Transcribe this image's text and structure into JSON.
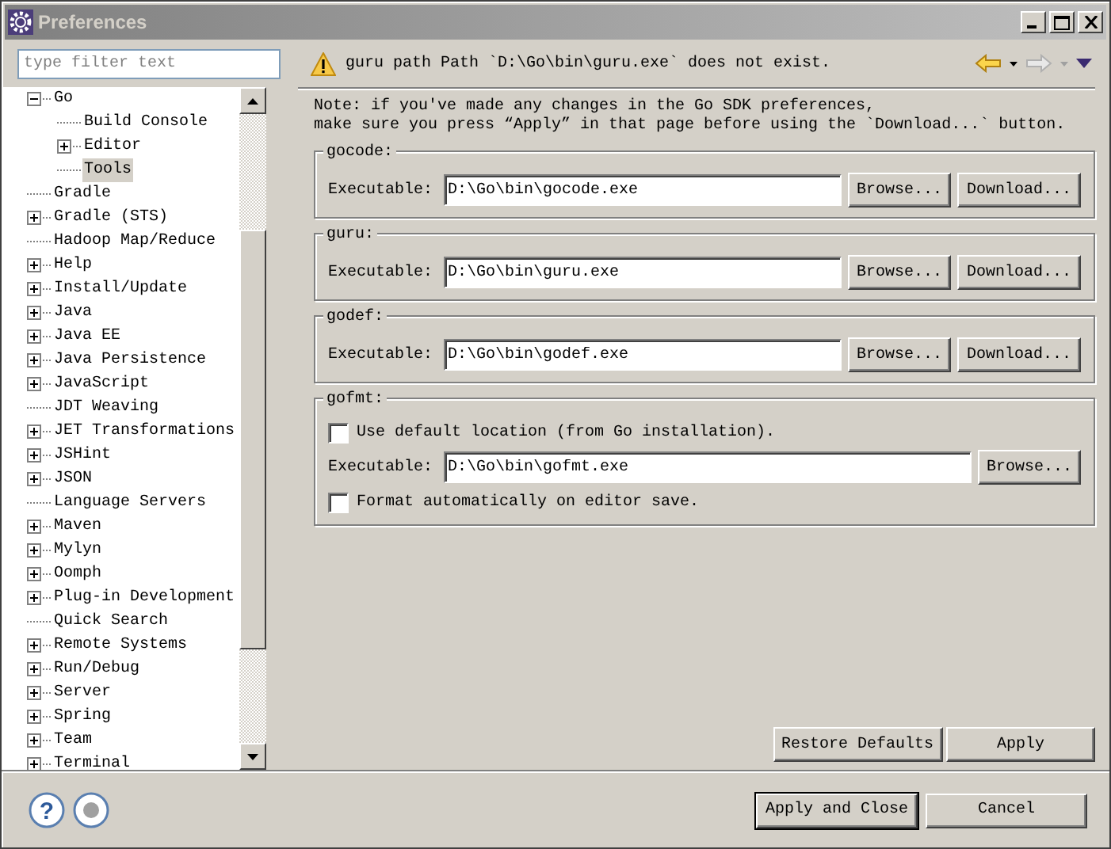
{
  "window": {
    "title": "Preferences"
  },
  "filter": {
    "placeholder": "type filter text"
  },
  "tree": [
    {
      "label": "Go",
      "expanded": true,
      "selected": false,
      "children": [
        {
          "label": "Build Console",
          "selected": false
        },
        {
          "label": "Editor",
          "expanded": false,
          "selected": false
        },
        {
          "label": "Tools",
          "selected": true
        }
      ]
    },
    {
      "label": "Gradle",
      "selected": false
    },
    {
      "label": "Gradle (STS)",
      "expanded": false,
      "selected": false
    },
    {
      "label": "Hadoop Map/Reduce",
      "selected": false
    },
    {
      "label": "Help",
      "expanded": false,
      "selected": false
    },
    {
      "label": "Install/Update",
      "expanded": false,
      "selected": false
    },
    {
      "label": "Java",
      "expanded": false,
      "selected": false
    },
    {
      "label": "Java EE",
      "expanded": false,
      "selected": false
    },
    {
      "label": "Java Persistence",
      "expanded": false,
      "selected": false
    },
    {
      "label": "JavaScript",
      "expanded": false,
      "selected": false
    },
    {
      "label": "JDT Weaving",
      "selected": false
    },
    {
      "label": "JET Transformations",
      "expanded": false,
      "selected": false
    },
    {
      "label": "JSHint",
      "expanded": false,
      "selected": false
    },
    {
      "label": "JSON",
      "expanded": false,
      "selected": false
    },
    {
      "label": "Language Servers",
      "selected": false
    },
    {
      "label": "Maven",
      "expanded": false,
      "selected": false
    },
    {
      "label": "Mylyn",
      "expanded": false,
      "selected": false
    },
    {
      "label": "Oomph",
      "expanded": false,
      "selected": false
    },
    {
      "label": "Plug-in Development",
      "expanded": false,
      "selected": false
    },
    {
      "label": "Quick Search",
      "selected": false
    },
    {
      "label": "Remote Systems",
      "expanded": false,
      "selected": false
    },
    {
      "label": "Run/Debug",
      "expanded": false,
      "selected": false
    },
    {
      "label": "Server",
      "expanded": false,
      "selected": false
    },
    {
      "label": "Spring",
      "expanded": false,
      "selected": false
    },
    {
      "label": "Team",
      "expanded": false,
      "selected": false
    },
    {
      "label": "Terminal",
      "expanded": false,
      "selected": false
    }
  ],
  "page": {
    "message": "guru path Path `D:\\Go\\bin\\guru.exe` does not exist.",
    "nav": {
      "back": {
        "disabled": false
      },
      "forward": {
        "disabled": true
      }
    },
    "note": [
      "Note: if you've made any changes in the Go SDK preferences,",
      "make sure you press “Apply” in that page before using the `Download...` button."
    ],
    "groups": [
      {
        "title": "gocode:",
        "rows": [
          {
            "kind": "field",
            "label": "Executable:",
            "value": "D:\\Go\\bin\\gocode.exe",
            "buttons": [
              "Browse...",
              "Download..."
            ]
          }
        ]
      },
      {
        "title": "guru:",
        "rows": [
          {
            "kind": "field",
            "label": "Executable:",
            "value": "D:\\Go\\bin\\guru.exe",
            "buttons": [
              "Browse...",
              "Download..."
            ]
          }
        ]
      },
      {
        "title": "godef:",
        "rows": [
          {
            "kind": "field",
            "label": "Executable:",
            "value": "D:\\Go\\bin\\godef.exe",
            "buttons": [
              "Browse...",
              "Download..."
            ]
          }
        ]
      },
      {
        "title": "gofmt:",
        "rows": [
          {
            "kind": "checkbox",
            "label": "Use default location (from Go installation).",
            "checked": false
          },
          {
            "kind": "field",
            "label": "Executable:",
            "value": "D:\\Go\\bin\\gofmt.exe",
            "buttons": [
              "Browse..."
            ]
          },
          {
            "kind": "checkbox",
            "label": "Format automatically on editor save.",
            "checked": false
          }
        ]
      }
    ],
    "buttons": [
      "Restore Defaults",
      "Apply"
    ]
  },
  "help_button": "?",
  "dialog_buttons": [
    {
      "label": "Apply and Close",
      "default": true
    },
    {
      "label": "Cancel",
      "default": false
    }
  ]
}
